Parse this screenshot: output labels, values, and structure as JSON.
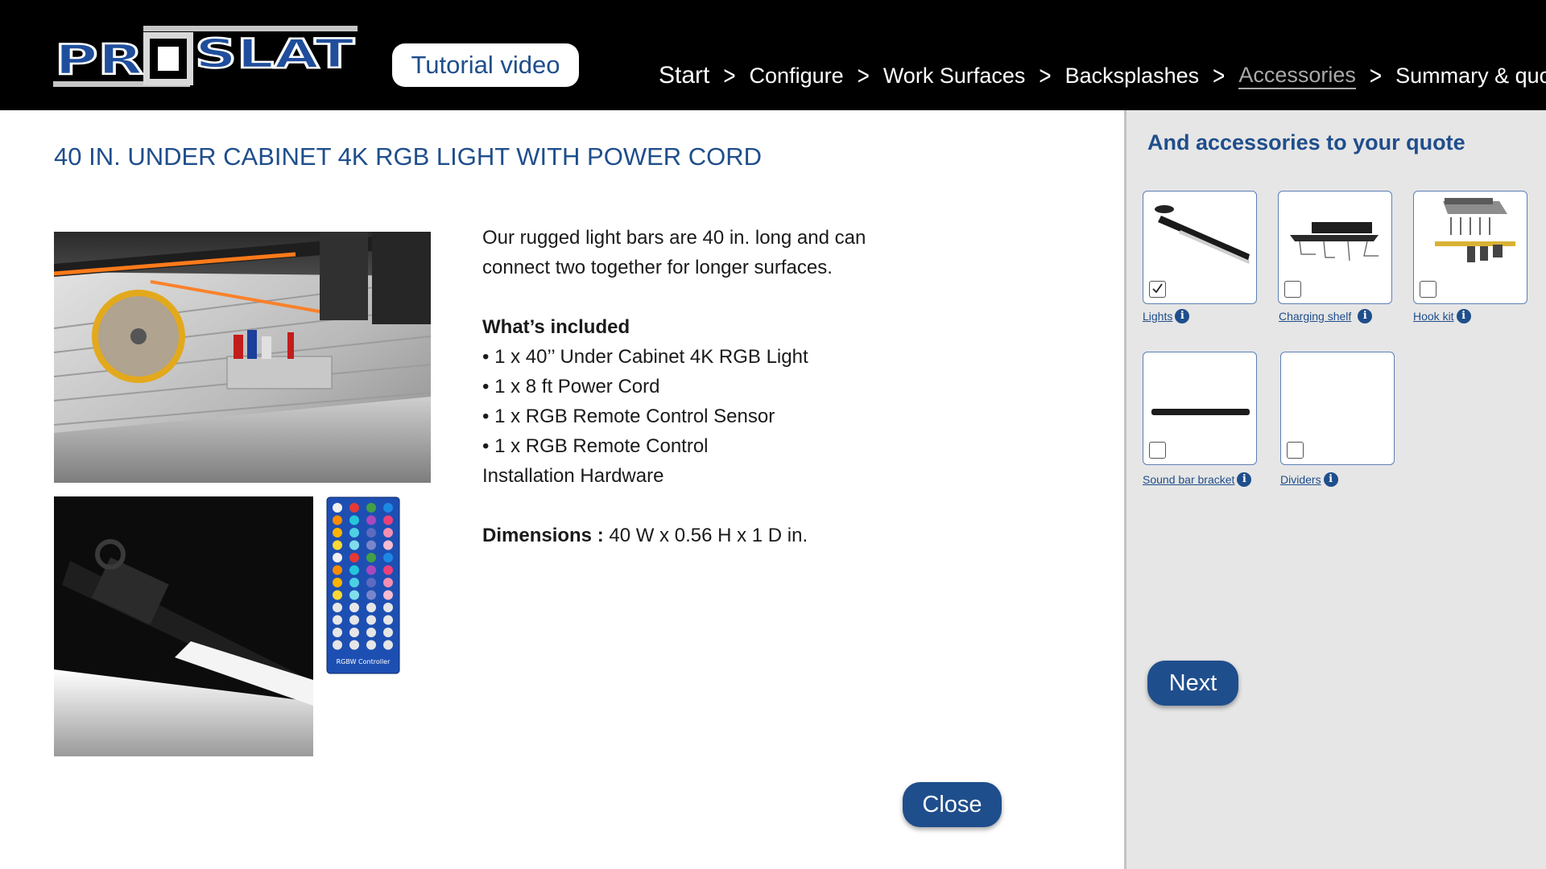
{
  "header": {
    "logo_text": "PROSLAT",
    "tutorial_button": "Tutorial video",
    "nav": [
      {
        "label": "Start"
      },
      {
        "label": "Configure"
      },
      {
        "label": "Work Surfaces"
      },
      {
        "label": "Backsplashes"
      },
      {
        "label": "Accessories",
        "current": true
      },
      {
        "label": "Summary & quote"
      }
    ],
    "separator": ">"
  },
  "product": {
    "title": "40 IN. UNDER CABINET 4K RGB LIGHT WITH POWER CORD",
    "description_line1": "Our rugged light bars are 40 in. long and can",
    "description_line2": "connect two together for longer surfaces.",
    "included_heading": "What’s included",
    "included_items": [
      "• 1 x 40’’ Under Cabinet 4K RGB Light",
      "• 1 x 8 ft Power Cord",
      "• 1 x RGB Remote Control Sensor",
      "• 1 x RGB Remote Control",
      "Installation Hardware"
    ],
    "dimensions_label": "Dimensions :",
    "dimensions_value": " 40 W  x  0.56 H x 1 D in.",
    "remote_caption": "RGBW Controller",
    "close_button": "Close"
  },
  "sidebar": {
    "title": "And accessories to your quote",
    "accessories": [
      {
        "label": "Lights",
        "checked": true,
        "icon": "info-icon"
      },
      {
        "label": "Charging shelf",
        "checked": false,
        "icon": "info-icon"
      },
      {
        "label": "Hook kit",
        "checked": false,
        "icon": "info-icon"
      },
      {
        "label": "Sound bar bracket ",
        "checked": false,
        "icon": "info-icon"
      },
      {
        "label": "Dividers",
        "checked": false,
        "icon": "info-icon"
      }
    ],
    "info_glyph": "i",
    "next_button": "Next"
  },
  "colors": {
    "brand_blue": "#1f4e8c",
    "header_bg": "#000000",
    "panel_bg": "#e6e6e6",
    "nav_current": "#a9a9a9"
  }
}
